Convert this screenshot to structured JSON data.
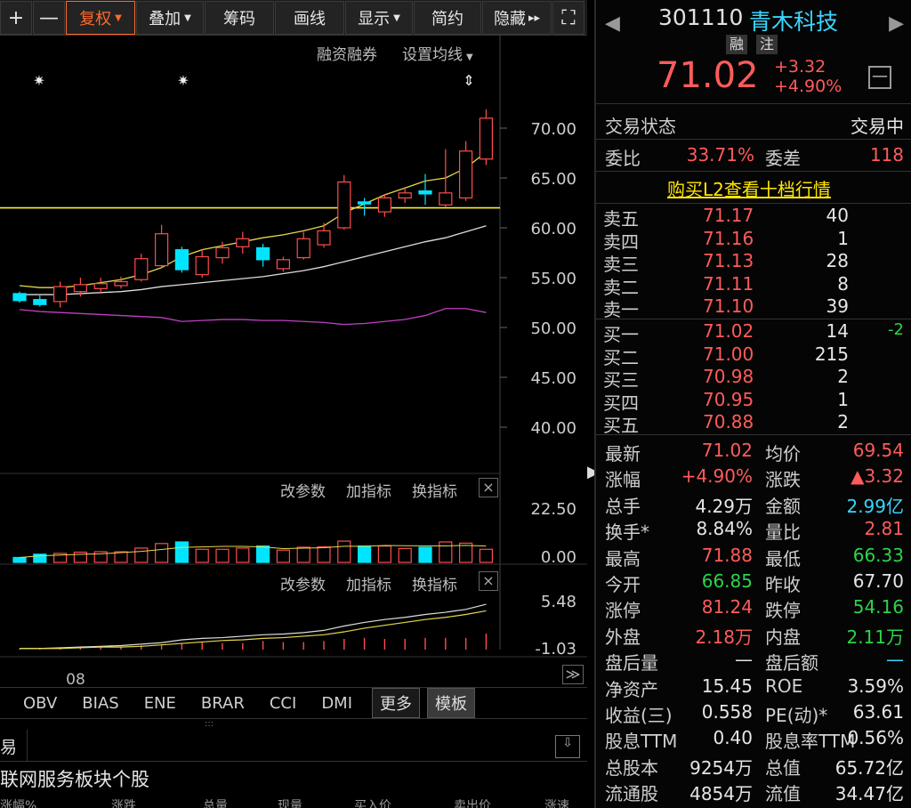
{
  "toolbar": {
    "plus": "+",
    "minus": "—",
    "fuquan": "复权",
    "diejia": "叠加",
    "chouma": "筹码",
    "huaxian": "画线",
    "xianshi": "显示",
    "jianyue": "简约",
    "yincang": "隐藏",
    "hide_glyph": "▸▸",
    "fullscreen_glyph": "⛶"
  },
  "chart_links": {
    "rzrq": "融资融券",
    "ma_setting": "设置均线"
  },
  "chart_data": {
    "type": "candlestick",
    "yticks": [
      "70.00",
      "65.00",
      "60.00",
      "55.00",
      "50.00",
      "45.00",
      "40.00"
    ],
    "ylim": [
      40,
      70
    ],
    "xlabel_month": "08",
    "reference_line": 62,
    "candles": [
      {
        "o": 53.4,
        "c": 52.7,
        "h": 53.6,
        "l": 52.5,
        "up": false
      },
      {
        "o": 52.3,
        "c": 52.8,
        "h": 53.2,
        "l": 52.1,
        "up": false
      },
      {
        "o": 52.6,
        "c": 54.1,
        "h": 54.6,
        "l": 52.0,
        "up": true
      },
      {
        "o": 53.6,
        "c": 54.3,
        "h": 55.0,
        "l": 53.1,
        "up": true
      },
      {
        "o": 53.9,
        "c": 54.4,
        "h": 55.0,
        "l": 53.4,
        "up": true
      },
      {
        "o": 54.2,
        "c": 54.6,
        "h": 55.1,
        "l": 53.9,
        "up": true
      },
      {
        "o": 54.8,
        "c": 56.9,
        "h": 57.4,
        "l": 54.6,
        "up": true
      },
      {
        "o": 56.2,
        "c": 59.4,
        "h": 60.3,
        "l": 56.0,
        "up": true
      },
      {
        "o": 57.8,
        "c": 55.8,
        "h": 58.1,
        "l": 55.5,
        "up": false
      },
      {
        "o": 55.3,
        "c": 57.1,
        "h": 57.8,
        "l": 55.0,
        "up": true
      },
      {
        "o": 57.0,
        "c": 58.0,
        "h": 58.6,
        "l": 56.4,
        "up": true
      },
      {
        "o": 58.1,
        "c": 58.9,
        "h": 59.6,
        "l": 57.4,
        "up": true
      },
      {
        "o": 58.0,
        "c": 56.8,
        "h": 58.4,
        "l": 56.1,
        "up": false
      },
      {
        "o": 55.9,
        "c": 56.8,
        "h": 57.1,
        "l": 55.6,
        "up": true
      },
      {
        "o": 57.0,
        "c": 58.9,
        "h": 59.6,
        "l": 56.8,
        "up": true
      },
      {
        "o": 58.3,
        "c": 59.7,
        "h": 60.5,
        "l": 58.0,
        "up": true
      },
      {
        "o": 60.0,
        "c": 64.6,
        "h": 65.3,
        "l": 59.8,
        "up": true
      },
      {
        "o": 62.4,
        "c": 62.6,
        "h": 63.0,
        "l": 61.2,
        "up": false
      },
      {
        "o": 61.6,
        "c": 63.0,
        "h": 63.4,
        "l": 61.1,
        "up": true
      },
      {
        "o": 63.0,
        "c": 63.5,
        "h": 64.0,
        "l": 62.5,
        "up": true
      },
      {
        "o": 63.7,
        "c": 63.4,
        "h": 65.4,
        "l": 62.3,
        "up": false
      },
      {
        "o": 62.3,
        "c": 63.5,
        "h": 67.9,
        "l": 62.1,
        "up": true
      },
      {
        "o": 63.0,
        "c": 67.7,
        "h": 68.7,
        "l": 62.7,
        "up": true
      },
      {
        "o": 66.9,
        "c": 71.0,
        "h": 71.9,
        "l": 66.3,
        "up": true
      }
    ],
    "ma5": [
      54.2,
      54.0,
      54.0,
      54.2,
      54.5,
      54.8,
      55.3,
      56.0,
      57.1,
      57.8,
      58.2,
      58.6,
      59.0,
      59.3,
      59.7,
      60.2,
      61.5,
      62.4,
      63.3,
      64.0,
      64.7,
      65.0,
      66.0,
      67.6
    ],
    "ma10": [
      53.3,
      53.3,
      53.3,
      53.4,
      53.5,
      53.6,
      53.8,
      54.1,
      54.3,
      54.5,
      54.7,
      54.9,
      55.1,
      55.4,
      55.7,
      56.1,
      56.6,
      57.1,
      57.6,
      58.1,
      58.6,
      59.0,
      59.6,
      60.2
    ],
    "ma_low": [
      51.8,
      51.6,
      51.5,
      51.4,
      51.3,
      51.2,
      51.1,
      51.0,
      50.6,
      50.7,
      50.8,
      50.8,
      50.7,
      50.7,
      50.6,
      50.5,
      50.3,
      50.4,
      50.6,
      50.8,
      51.2,
      51.9,
      51.9,
      51.5
    ],
    "volume": {
      "yticks": [
        "22.50",
        "0.00"
      ],
      "bars": [
        1.2,
        2.0,
        2.2,
        2.5,
        2.6,
        2.6,
        3.5,
        4.6,
        5.0,
        3.2,
        3.2,
        3.5,
        4.0,
        3.0,
        3.7,
        3.8,
        5.2,
        4.0,
        4.0,
        3.4,
        3.7,
        5.0,
        4.7,
        3.2
      ],
      "up": [
        false,
        false,
        true,
        true,
        true,
        true,
        true,
        true,
        false,
        true,
        true,
        true,
        false,
        true,
        true,
        true,
        true,
        false,
        true,
        true,
        false,
        true,
        true,
        true
      ]
    },
    "indicator": {
      "yticks": [
        "5.48",
        "-1.03"
      ],
      "line_a": [
        -1.0,
        -1.0,
        -0.9,
        -0.8,
        -0.7,
        -0.6,
        -0.4,
        -0.2,
        0.2,
        0.4,
        0.5,
        0.7,
        0.9,
        1.0,
        1.2,
        1.5,
        2.1,
        2.6,
        3.0,
        3.3,
        3.7,
        4.0,
        4.4,
        5.1
      ],
      "line_b": [
        -1.0,
        -1.0,
        -1.0,
        -0.9,
        -0.8,
        -0.8,
        -0.7,
        -0.5,
        -0.3,
        -0.1,
        0.1,
        0.2,
        0.4,
        0.5,
        0.7,
        0.9,
        1.3,
        1.8,
        2.2,
        2.6,
        3.0,
        3.3,
        3.7,
        4.2
      ],
      "hist": [
        0.1,
        0.1,
        0.2,
        0.3,
        0.3,
        0.3,
        0.4,
        0.5,
        0.6,
        0.7,
        0.6,
        0.6,
        0.8,
        0.7,
        0.7,
        0.8,
        1.0,
        1.1,
        1.0,
        1.0,
        1.1,
        1.1,
        1.1,
        1.5
      ]
    }
  },
  "indicator_menu": {
    "params": "改参数",
    "add": "加指标",
    "switch": "换指标",
    "close": "×",
    "expand": "≫"
  },
  "tabs": {
    "items": [
      "OBV",
      "BIAS",
      "ENE",
      "BRAR",
      "CCI",
      "DMI"
    ],
    "more": "更多",
    "template": "模板"
  },
  "grip": ":::",
  "panel": {
    "title_fragment": "易",
    "download_icon": "⇩"
  },
  "board_title": "联网服务板块个股",
  "list_header": [
    "涨幅%",
    "涨跌",
    "总量",
    "现量",
    "买入价",
    "卖出价",
    "涨速"
  ],
  "collapse_glyph": "▶",
  "quote": {
    "code": "301110",
    "name": "青木科技",
    "badge_rong": "融",
    "badge_zhu": "注",
    "price": "71.02",
    "change": "+3.32",
    "change_pct": "+4.90%",
    "nav_left": "◀",
    "nav_right": "▶",
    "minus_box": "—"
  },
  "status": {
    "label": "交易状态",
    "value": "交易中"
  },
  "weibi": {
    "label": "委比",
    "value": "33.71%",
    "diff_label": "委差",
    "diff_value": "118"
  },
  "promo": "购买L2查看十档行情",
  "orderbook": {
    "asks": [
      {
        "label": "卖五",
        "price": "71.17",
        "vol": "40"
      },
      {
        "label": "卖四",
        "price": "71.16",
        "vol": "1"
      },
      {
        "label": "卖三",
        "price": "71.13",
        "vol": "28"
      },
      {
        "label": "卖二",
        "price": "71.11",
        "vol": "8"
      },
      {
        "label": "卖一",
        "price": "71.10",
        "vol": "39"
      }
    ],
    "bids": [
      {
        "label": "买一",
        "price": "71.02",
        "vol": "14",
        "delta": "-2"
      },
      {
        "label": "买二",
        "price": "71.00",
        "vol": "215",
        "delta": ""
      },
      {
        "label": "买三",
        "price": "70.98",
        "vol": "2",
        "delta": ""
      },
      {
        "label": "买四",
        "price": "70.95",
        "vol": "1",
        "delta": ""
      },
      {
        "label": "买五",
        "price": "70.88",
        "vol": "2",
        "delta": ""
      }
    ]
  },
  "stats": [
    {
      "l1": "最新",
      "v1": "71.02",
      "c1": "red",
      "l2": "均价",
      "v2": "69.54",
      "c2": "red"
    },
    {
      "l1": "涨幅",
      "v1": "+4.90%",
      "c1": "red",
      "l2": "涨跌",
      "v2": "▲3.32",
      "c2": "red"
    },
    {
      "l1": "总手",
      "v1": "4.29万",
      "c1": "white",
      "l2": "金额",
      "v2": "2.99亿",
      "c2": "cyan"
    },
    {
      "l1": "换手*",
      "v1": "8.84%",
      "c1": "white",
      "l2": "量比",
      "v2": "2.81",
      "c2": "red"
    },
    {
      "l1": "最高",
      "v1": "71.88",
      "c1": "red",
      "l2": "最低",
      "v2": "66.33",
      "c2": "green"
    },
    {
      "l1": "今开",
      "v1": "66.85",
      "c1": "green",
      "l2": "昨收",
      "v2": "67.70",
      "c2": "white"
    },
    {
      "l1": "涨停",
      "v1": "81.24",
      "c1": "red",
      "l2": "跌停",
      "v2": "54.16",
      "c2": "green"
    },
    {
      "l1": "外盘",
      "v1": "2.18万",
      "c1": "red",
      "l2": "内盘",
      "v2": "2.11万",
      "c2": "green"
    },
    {
      "l1": "盘后量",
      "v1": "—",
      "c1": "white",
      "l2": "盘后额",
      "v2": "—",
      "c2": "cyan"
    },
    {
      "l1": "净资产",
      "v1": "15.45",
      "c1": "white",
      "l2": "ROE",
      "v2": "3.59%",
      "c2": "white"
    },
    {
      "l1": "收益(三)",
      "v1": "0.558",
      "c1": "white",
      "l2": "PE(动)*",
      "v2": "63.61",
      "c2": "white"
    },
    {
      "l1": "股息TTM",
      "v1": "0.40",
      "c1": "white",
      "l2": "股息率TTM",
      "v2": "0.56%",
      "c2": "white"
    },
    {
      "l1": "总股本",
      "v1": "9254万",
      "c1": "white",
      "l2": "总值",
      "v2": "65.72亿",
      "c2": "white"
    },
    {
      "l1": "流通股",
      "v1": "4854万",
      "c1": "white",
      "l2": "流值",
      "v2": "34.47亿",
      "c2": "white"
    }
  ]
}
